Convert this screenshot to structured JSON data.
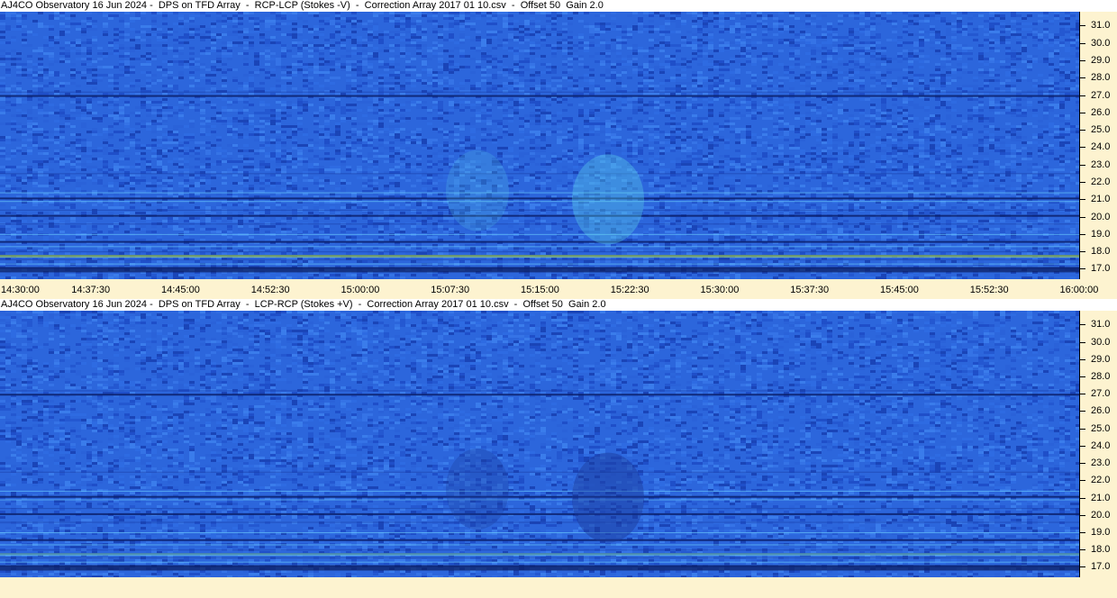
{
  "panels": [
    {
      "title": "AJ4CO Observatory 16 Jun 2024 -  DPS on TFD Array  -  RCP-LCP (Stokes -V)  -  Correction Array 2017 01 10.csv  -  Offset 50  Gain 2.0",
      "polarity": "RCP-LCP"
    },
    {
      "title": "AJ4CO Observatory 16 Jun 2024 -  DPS on TFD Array  -  LCP-RCP (Stokes +V)  -  Correction Array 2017 01 10.csv  -  Offset 50  Gain 2.0",
      "polarity": "LCP-RCP"
    }
  ],
  "colors": {
    "background": "#2a62d9",
    "axis_panel": "#fdf3d0",
    "title_bg": "#ffffff"
  },
  "chart_data": [
    {
      "type": "heatmap",
      "title": "AJ4CO Observatory 16 Jun 2024 -  DPS on TFD Array  -  RCP-LCP (Stokes -V)  -  Correction Array 2017 01 10.csv  -  Offset 50  Gain 2.0",
      "x_tick_labels": [
        "14:30:00",
        "14:37:30",
        "14:45:00",
        "14:52:30",
        "15:00:00",
        "15:07:30",
        "15:15:00",
        "15:22:30",
        "15:30:00",
        "15:37:30",
        "15:45:00",
        "15:52:30",
        "16:00:00"
      ],
      "y_tick_labels": [
        "17.0",
        "18.0",
        "19.0",
        "20.0",
        "21.0",
        "22.0",
        "23.0",
        "24.0",
        "25.0",
        "26.0",
        "27.0",
        "28.0",
        "29.0",
        "30.0",
        "31.0"
      ],
      "ylim": [
        16.4,
        31.8
      ],
      "xlim": [
        "14:30:00",
        "16:00:00"
      ],
      "y_axis_position": "right"
    },
    {
      "type": "heatmap",
      "title": "AJ4CO Observatory 16 Jun 2024 -  DPS on TFD Array  -  LCP-RCP (Stokes +V)  -  Correction Array 2017 01 10.csv  -  Offset 50  Gain 2.0",
      "x_tick_labels": [],
      "y_tick_labels": [
        "17.0",
        "18.0",
        "19.0",
        "20.0",
        "21.0",
        "22.0",
        "23.0",
        "24.0",
        "25.0",
        "26.0",
        "27.0",
        "28.0",
        "29.0",
        "30.0",
        "31.0"
      ],
      "ylim": [
        16.4,
        31.8
      ],
      "xlim": [
        "14:30:00",
        "16:00:00"
      ],
      "y_axis_position": "right"
    }
  ]
}
